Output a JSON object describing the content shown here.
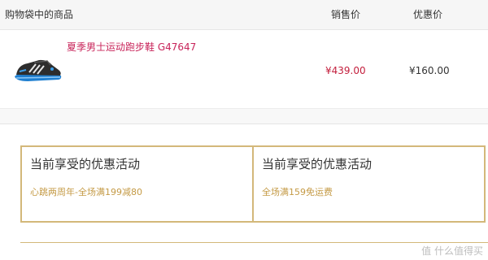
{
  "header": {
    "items_label": "购物袋中的商品",
    "sale_price_label": "销售价",
    "discount_price_label": "优惠价"
  },
  "product": {
    "name": "夏季男士运动跑步鞋 G47647",
    "sale_price": "¥439.00",
    "discount_price": "¥160.00",
    "thumbnail_icon": "running-shoe-icon"
  },
  "promotions": [
    {
      "title": "当前享受的优惠活动",
      "detail": "心跳两周年-全场满199减80"
    },
    {
      "title": "当前享受的优惠活动",
      "detail": "全场满159免运费"
    }
  ],
  "watermark": "值 什么值得买",
  "colors": {
    "product_name": "#c8245a",
    "sale_price": "#c31e3c",
    "promo_border": "#d3b87a",
    "promo_detail": "#c49a45"
  }
}
